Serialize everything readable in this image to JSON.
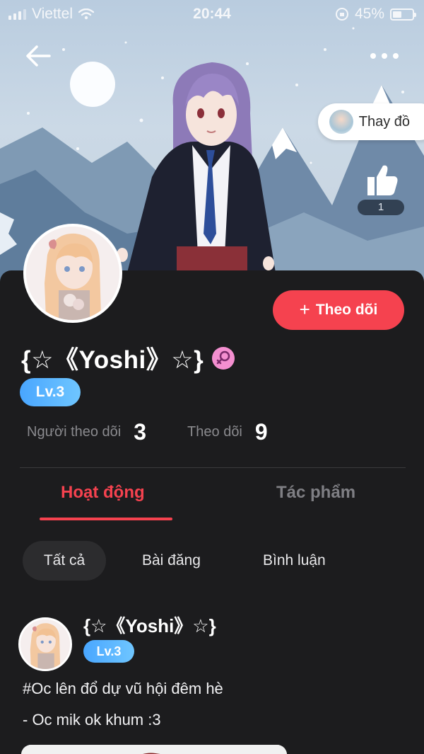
{
  "status_bar": {
    "carrier": "Viettel",
    "time": "20:44",
    "battery": "45%",
    "battery_level": 0.45
  },
  "header": {
    "change_outfit_label": "Thay đồ",
    "like_count": "1"
  },
  "profile": {
    "username": "{☆《Yoshi》☆}",
    "level": "Lv.3",
    "follow_button": "Theo dõi",
    "followers_label": "Người theo dõi",
    "followers_count": "3",
    "following_label": "Theo dõi",
    "following_count": "9"
  },
  "tabs": [
    {
      "label": "Hoạt động",
      "active": true
    },
    {
      "label": "Tác phẩm",
      "active": false
    }
  ],
  "filters": [
    {
      "label": "Tất cả",
      "selected": true
    },
    {
      "label": "Bài đăng",
      "selected": false
    },
    {
      "label": "Bình luận",
      "selected": false
    }
  ],
  "post": {
    "author": "{☆《Yoshi》☆}",
    "level": "Lv.3",
    "lines": [
      "#Oc lên đổ dự vũ hội đêm hè",
      "- Oc mik ok khum :3"
    ]
  },
  "colors": {
    "accent": "#f5424f",
    "level_badge": "#49a6ff",
    "background": "#1c1c1e",
    "gender_badge": "#f48fd0"
  },
  "icons": [
    "back-arrow-icon",
    "more-dots-icon",
    "thumbs-up-icon",
    "wifi-icon",
    "signal-icon",
    "battery-icon",
    "female-gender-icon",
    "plus-icon"
  ]
}
